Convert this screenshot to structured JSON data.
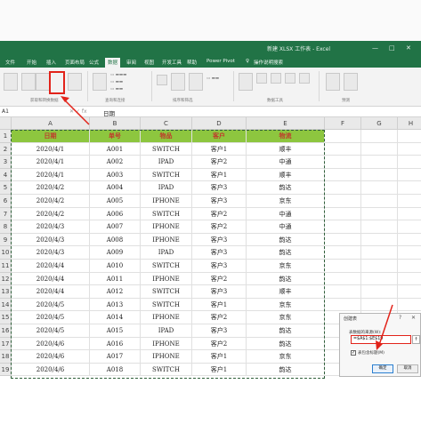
{
  "window": {
    "title": "新建 XLSX 工作表 - Excel",
    "controls": [
      "—",
      "□",
      "✕"
    ]
  },
  "menu": {
    "tabs": [
      "文件",
      "开始",
      "插入",
      "页面布局",
      "公式",
      "数据",
      "审阅",
      "视图",
      "开发工具",
      "帮助",
      "Power Pivot",
      "操作说明搜索"
    ],
    "active": "数据",
    "search_icon": "lightbulb-icon"
  },
  "ribbon": {
    "group_get": "获取和转换数据",
    "group_query": "查询和连接",
    "group_sort": "排序和筛选",
    "group_tools": "数据工具",
    "group_forecast": "预测"
  },
  "formula_bar": {
    "name_box": "A1",
    "fx": "✕ ✓ fx",
    "value": "日期"
  },
  "sheet": {
    "columns": [
      "A",
      "B",
      "C",
      "D",
      "E",
      "F",
      "G",
      "H"
    ],
    "row_numbers": [
      "1",
      "2",
      "3",
      "4",
      "5",
      "6",
      "7",
      "8",
      "9",
      "10",
      "11",
      "12",
      "13",
      "14",
      "15",
      "16",
      "17",
      "18",
      "19"
    ],
    "header": [
      "日期",
      "单号",
      "物品",
      "客户",
      "物流"
    ],
    "rows": [
      [
        "2020/4/1",
        "A001",
        "SWITCH",
        "客户1",
        "顺丰"
      ],
      [
        "2020/4/1",
        "A002",
        "IPAD",
        "客户2",
        "中通"
      ],
      [
        "2020/4/1",
        "A003",
        "SWITCH",
        "客户1",
        "顺丰"
      ],
      [
        "2020/4/2",
        "A004",
        "IPAD",
        "客户3",
        "韵达"
      ],
      [
        "2020/4/2",
        "A005",
        "IPHONE",
        "客户3",
        "京东"
      ],
      [
        "2020/4/2",
        "A006",
        "SWITCH",
        "客户2",
        "中通"
      ],
      [
        "2020/4/3",
        "A007",
        "IPHONE",
        "客户2",
        "中通"
      ],
      [
        "2020/4/3",
        "A008",
        "IPHONE",
        "客户3",
        "韵达"
      ],
      [
        "2020/4/3",
        "A009",
        "IPAD",
        "客户3",
        "韵达"
      ],
      [
        "2020/4/4",
        "A010",
        "SWITCH",
        "客户3",
        "京东"
      ],
      [
        "2020/4/4",
        "A011",
        "IPHONE",
        "客户2",
        "韵达"
      ],
      [
        "2020/4/4",
        "A012",
        "SWITCH",
        "客户3",
        "顺丰"
      ],
      [
        "2020/4/5",
        "A013",
        "SWITCH",
        "客户1",
        "京东"
      ],
      [
        "2020/4/5",
        "A014",
        "IPHONE",
        "客户2",
        "京东"
      ],
      [
        "2020/4/5",
        "A015",
        "IPAD",
        "客户3",
        "韵达"
      ],
      [
        "2020/4/6",
        "A016",
        "IPHONE",
        "客户2",
        "韵达"
      ],
      [
        "2020/4/6",
        "A017",
        "IPHONE",
        "客户1",
        "京东"
      ],
      [
        "2020/4/6",
        "A018",
        "SWITCH",
        "客户1",
        "韵达"
      ]
    ],
    "header_fill": "#8dc63f",
    "header_text_color": "#c0392b"
  },
  "dialog": {
    "title": "创建表",
    "help": "?",
    "close": "✕",
    "label": "表数据的来源(W):",
    "range": "=$A$1:$E$19",
    "picker_icon": "↑",
    "checkbox_checked": "✓",
    "checkbox_label": "表包含标题(M)",
    "ok": "确定",
    "cancel": "取消"
  },
  "accent": "#217346",
  "highlight": "#e2231a"
}
